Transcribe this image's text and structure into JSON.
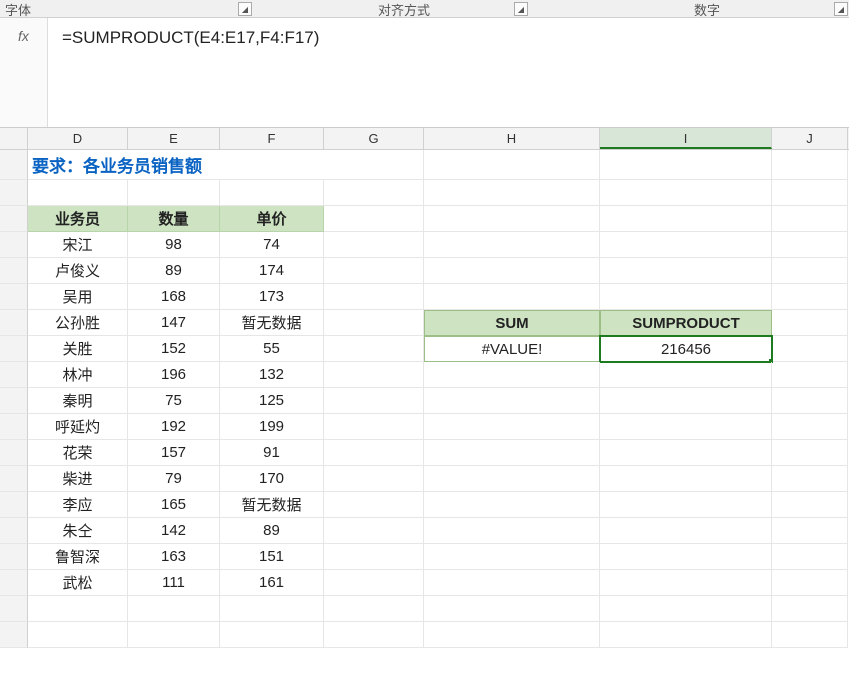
{
  "ribbon": {
    "font_label": "字体",
    "align_label": "对齐方式",
    "number_label": "数字"
  },
  "formula_bar": {
    "fx": "fx",
    "value": "=SUMPRODUCT(E4:E17,F4:F17)"
  },
  "columns": [
    "D",
    "E",
    "F",
    "G",
    "H",
    "I",
    "J"
  ],
  "active_column": "I",
  "title": "要求：各业务员销售额",
  "table_headers": {
    "agent": "业务员",
    "qty": "数量",
    "price": "单价"
  },
  "table": [
    {
      "agent": "宋江",
      "qty": "98",
      "price": "74"
    },
    {
      "agent": "卢俊义",
      "qty": "89",
      "price": "174"
    },
    {
      "agent": "吴用",
      "qty": "168",
      "price": "173"
    },
    {
      "agent": "公孙胜",
      "qty": "147",
      "price": "暂无数据"
    },
    {
      "agent": "关胜",
      "qty": "152",
      "price": "55"
    },
    {
      "agent": "林冲",
      "qty": "196",
      "price": "132"
    },
    {
      "agent": "秦明",
      "qty": "75",
      "price": "125"
    },
    {
      "agent": "呼延灼",
      "qty": "192",
      "price": "199"
    },
    {
      "agent": "花荣",
      "qty": "157",
      "price": "91"
    },
    {
      "agent": "柴进",
      "qty": "79",
      "price": "170"
    },
    {
      "agent": "李应",
      "qty": "165",
      "price": "暂无数据"
    },
    {
      "agent": "朱仝",
      "qty": "142",
      "price": "89"
    },
    {
      "agent": "鲁智深",
      "qty": "163",
      "price": "151"
    },
    {
      "agent": "武松",
      "qty": "111",
      "price": "161"
    }
  ],
  "mini": {
    "sum_label": "SUM",
    "sumproduct_label": "SUMPRODUCT",
    "sum_value": "#VALUE!",
    "sumproduct_value": "216456"
  }
}
